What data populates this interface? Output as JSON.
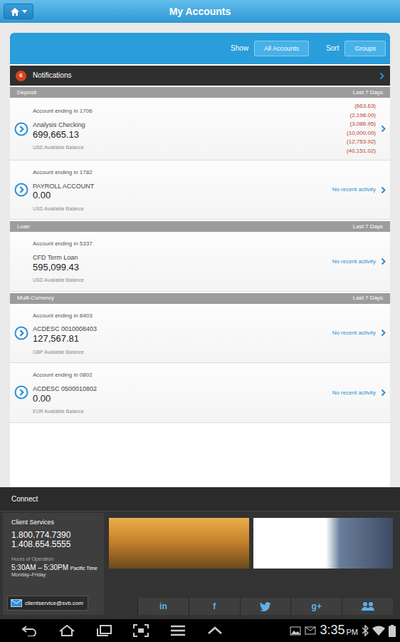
{
  "app_bar": {
    "title": "My Accounts"
  },
  "toolbar": {
    "show_label": "Show",
    "show_button": "All Accounts",
    "sort_label": "Sort",
    "sort_button": "Groups"
  },
  "notifications": {
    "count": "6",
    "label": "Notifications"
  },
  "groups": [
    {
      "name": "Deposit",
      "period": "Last 7 Days",
      "accounts": [
        {
          "ending": "Account ending in 1706",
          "name": "Analysis Checking",
          "balance": "699,665.13",
          "balance_label": "USD Available Balance",
          "expandable": true,
          "kind": "transactions",
          "transactions": [
            "(663.63)",
            "(2,198.00)",
            "(3,086.95)",
            "(10,000.00)",
            "(12,753.92)",
            "(40,151.02)"
          ]
        },
        {
          "ending": "Account ending in 1782",
          "name": "PAYROLL ACCOUNT",
          "balance": "0.00",
          "balance_label": "USD Available Balance",
          "expandable": true,
          "kind": "none",
          "activity_text": "No recent activity"
        }
      ]
    },
    {
      "name": "Loan",
      "period": "Last 7 Days",
      "accounts": [
        {
          "ending": "Account ending in 5337",
          "name": "CFD Term Loan",
          "balance": "595,099.43",
          "balance_label": "USD Available Balance",
          "expandable": false,
          "kind": "none",
          "activity_text": "No recent activity"
        }
      ]
    },
    {
      "name": "Multi-Currency",
      "period": "Last 7 Days",
      "accounts": [
        {
          "ending": "Account ending in 8403",
          "name": "ACDESC 0010008403",
          "balance": "127,567.81",
          "balance_label": "GBP Available Balance",
          "expandable": true,
          "kind": "none",
          "activity_text": "No recent activity"
        },
        {
          "ending": "Account ending in 0802",
          "name": "ACDESC 0500010802",
          "balance": "0.00",
          "balance_label": "EUR Available Balance",
          "expandable": true,
          "kind": "none",
          "activity_text": "No recent activity"
        }
      ]
    }
  ],
  "connect": {
    "title": "Connect",
    "client_services": {
      "title": "Client Services",
      "phones": [
        "1.800.774.7390",
        "1.408.654.5555"
      ],
      "hours_label": "Hours of Operation",
      "hours": "5:30AM – 5:30PM",
      "timezone": "Pacific Time",
      "days": "Monday–Friday"
    },
    "email": "clientservice@svb.com",
    "social": [
      {
        "kind": "glyph",
        "label": "in"
      },
      {
        "kind": "glyph",
        "label": "f"
      },
      {
        "kind": "bird"
      },
      {
        "kind": "glyph",
        "label": "g+"
      },
      {
        "kind": "people"
      }
    ]
  },
  "system_bar": {
    "time": "3:35",
    "ampm": "PM"
  }
}
